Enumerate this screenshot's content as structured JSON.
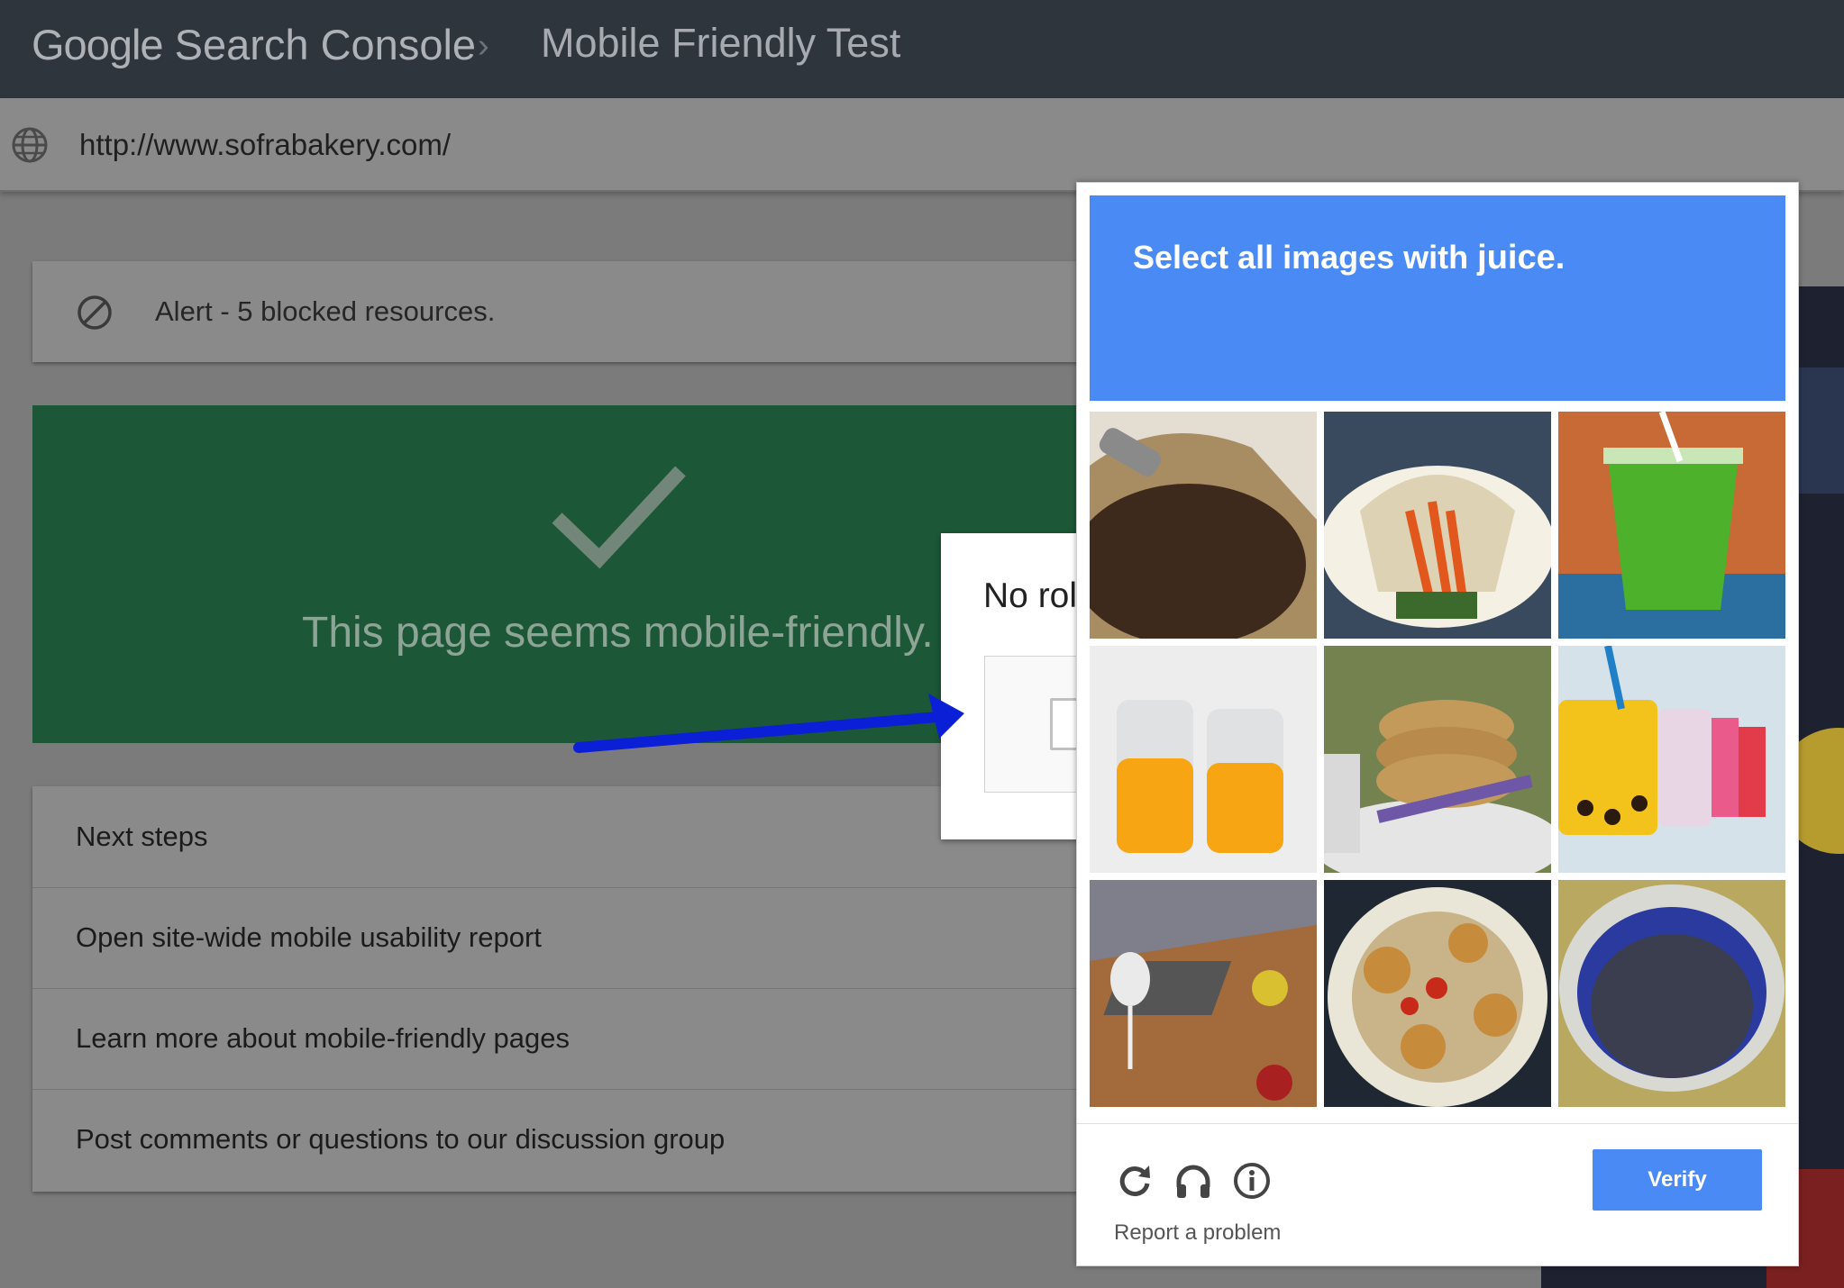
{
  "app": {
    "brand_google": "Google",
    "brand_product": "Search Console",
    "breadcrumb_sep": "›",
    "page_title": "Mobile Friendly Test"
  },
  "urlbar": {
    "icon": "globe-icon",
    "url": "http://www.sofrabakery.com/"
  },
  "alert": {
    "icon": "blocked-icon",
    "text": "Alert - 5 blocked resources."
  },
  "result": {
    "icon": "checkmark-icon",
    "text": "This page seems mobile-friendly.",
    "color": "#1c5837"
  },
  "steps": {
    "title": "Next steps",
    "items": [
      "Open site-wide mobile usability report",
      "Learn more about mobile-friendly pages",
      "Post comments or questions to our discussion group"
    ]
  },
  "recaptcha_anchor": {
    "partial_label": "No rol"
  },
  "challenge": {
    "instruction": "Select all images with ",
    "target": "juice.",
    "accent": "#4a8af4",
    "tiles": [
      "coffee beans in burlap sack",
      "sandwich with carrots",
      "green juice cup with straw",
      "two glasses of orange juice",
      "stack of cookies with lavender",
      "bubble tea drinks",
      "office table with laptop and glass",
      "plate of scallops",
      "pot of dark liquid"
    ],
    "controls": [
      "reload-icon",
      "headphones-icon",
      "info-icon"
    ],
    "report": "Report a problem",
    "verify": "Verify"
  }
}
